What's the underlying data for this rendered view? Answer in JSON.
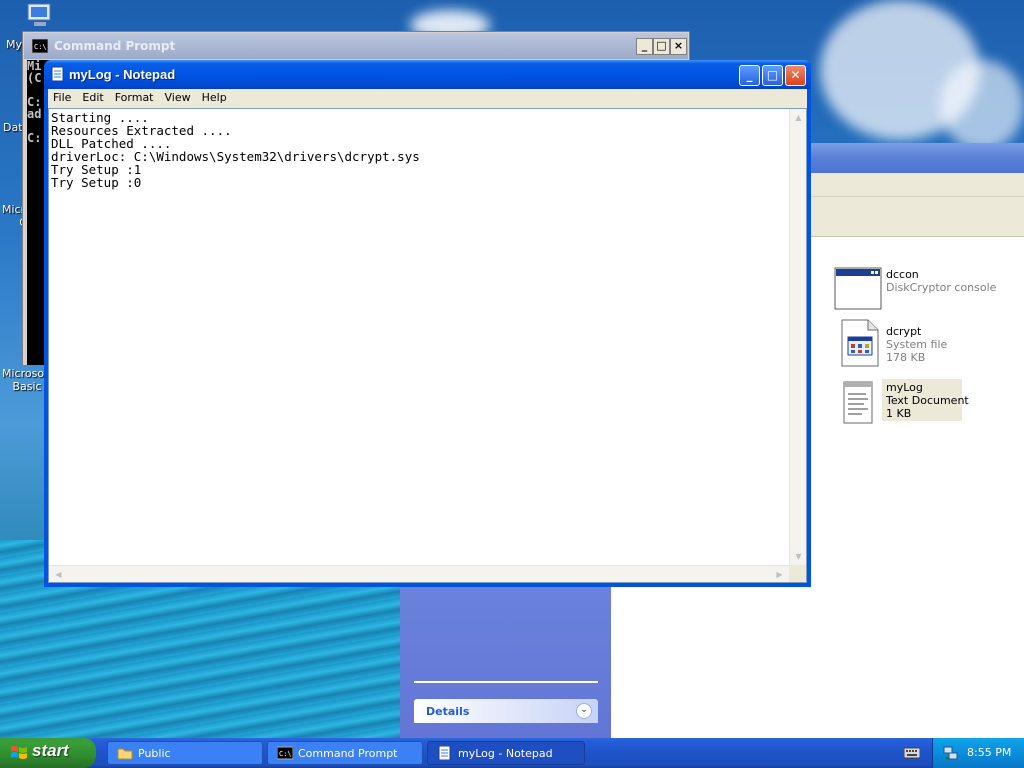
{
  "desktop": {
    "icons": [
      {
        "label": "My"
      },
      {
        "label": "Data"
      },
      {
        "label": "Microso\nC"
      },
      {
        "label": "Microsoft\nBasic"
      }
    ]
  },
  "explorer": {
    "details_label": "Details",
    "files": [
      {
        "name": "dccon",
        "type": "DiskCryptor console",
        "size": ""
      },
      {
        "name": "dcrypt",
        "type": "System file",
        "size": "178 KB"
      },
      {
        "name": "myLog",
        "type": "Text Document",
        "size": "1 KB"
      }
    ]
  },
  "cmd": {
    "title": "Command Prompt",
    "console_lines": [
      "Mi",
      "(C",
      "",
      "C:",
      "ad",
      "",
      "C:"
    ]
  },
  "notepad": {
    "title": "myLog - Notepad",
    "menu": [
      "File",
      "Edit",
      "Format",
      "View",
      "Help"
    ],
    "content": "Starting ....\nResources Extracted ....\nDLL Patched ....\ndriverLoc: C:\\Windows\\System32\\drivers\\dcrypt.sys\nTry Setup :1\nTry Setup :0"
  },
  "taskbar": {
    "start_label": "start",
    "tasks": [
      {
        "label": "Public"
      },
      {
        "label": "Command Prompt"
      },
      {
        "label": "myLog - Notepad"
      }
    ],
    "clock": "8:55 PM"
  },
  "colors": {
    "xp_blue": "#0054e3",
    "start_green": "#389e38",
    "taskbar_blue": "#245edb",
    "tray_blue": "#0b8ddd"
  }
}
